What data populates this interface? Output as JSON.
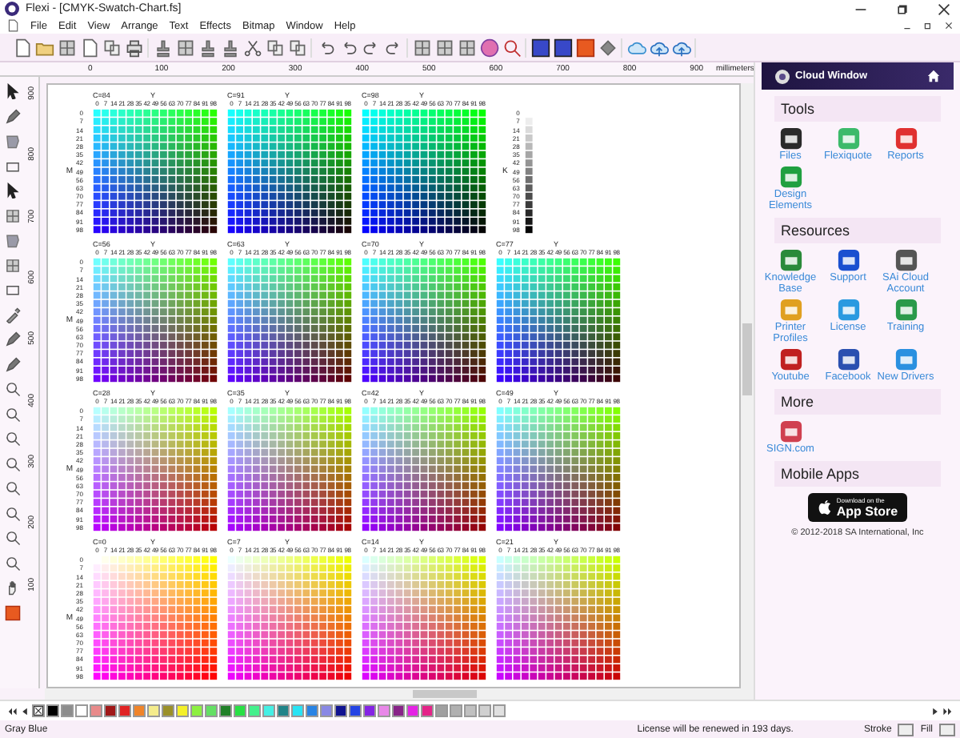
{
  "window": {
    "title": "Flexi - [CMYK-Swatch-Chart.fs]"
  },
  "menu": [
    "File",
    "Edit",
    "View",
    "Arrange",
    "Text",
    "Effects",
    "Bitmap",
    "Window",
    "Help"
  ],
  "ruler": {
    "ticks": [
      "0",
      "100",
      "200",
      "300",
      "400",
      "500",
      "600",
      "700",
      "800",
      "900"
    ],
    "unit": "millimeters",
    "vertical_ticks": [
      "900",
      "800",
      "700",
      "600",
      "500",
      "400",
      "300",
      "200",
      "100"
    ]
  },
  "swatch_chart": {
    "rows": [
      {
        "m_label": "M",
        "m_ticks": [
          "0",
          "7",
          "14",
          "21",
          "28",
          "35",
          "42",
          "49",
          "56",
          "63",
          "70",
          "77",
          "84",
          "91",
          "98"
        ],
        "grids": [
          {
            "label": "C=84",
            "y_label": "Y",
            "y_ticks": [
              "0",
              "7",
              "14",
              "21",
              "28",
              "35",
              "42",
              "49",
              "56",
              "63",
              "70",
              "77",
              "84",
              "91",
              "98"
            ]
          },
          {
            "label": "C=91",
            "y_label": "Y",
            "y_ticks": [
              "0",
              "7",
              "14",
              "21",
              "28",
              "35",
              "42",
              "49",
              "56",
              "63",
              "70",
              "77",
              "84",
              "91",
              "98"
            ]
          },
          {
            "label": "C=98",
            "y_label": "Y",
            "y_ticks": [
              "0",
              "7",
              "14",
              "21",
              "28",
              "35",
              "42",
              "49",
              "56",
              "63",
              "70",
              "77",
              "84",
              "91",
              "98"
            ]
          }
        ]
      },
      {
        "m_label": "M",
        "m_ticks": [
          "0",
          "7",
          "14",
          "21",
          "28",
          "35",
          "42",
          "49",
          "56",
          "63",
          "70",
          "77",
          "84",
          "91",
          "98"
        ],
        "grids": [
          {
            "label": "C=56",
            "y_label": "Y",
            "y_ticks": [
              "0",
              "7",
              "14",
              "21",
              "28",
              "35",
              "42",
              "49",
              "56",
              "63",
              "70",
              "77",
              "84",
              "91",
              "98"
            ]
          },
          {
            "label": "C=63",
            "y_label": "Y",
            "y_ticks": [
              "0",
              "7",
              "14",
              "21",
              "28",
              "35",
              "42",
              "49",
              "56",
              "63",
              "70",
              "77",
              "84",
              "91",
              "98"
            ]
          },
          {
            "label": "C=70",
            "y_label": "Y",
            "y_ticks": [
              "0",
              "7",
              "14",
              "21",
              "28",
              "35",
              "42",
              "49",
              "56",
              "63",
              "70",
              "77",
              "84",
              "91",
              "98"
            ]
          },
          {
            "label": "C=77",
            "y_label": "Y",
            "y_ticks": [
              "0",
              "7",
              "14",
              "21",
              "28",
              "35",
              "42",
              "49",
              "56",
              "63",
              "70",
              "77",
              "84",
              "91",
              "98"
            ]
          }
        ]
      },
      {
        "m_label": "M",
        "m_ticks": [
          "0",
          "7",
          "14",
          "21",
          "28",
          "35",
          "42",
          "49",
          "56",
          "63",
          "70",
          "77",
          "84",
          "91",
          "98"
        ],
        "grids": [
          {
            "label": "C=28",
            "y_label": "Y",
            "y_ticks": [
              "0",
              "7",
              "14",
              "21",
              "28",
              "35",
              "42",
              "49",
              "56",
              "63",
              "70",
              "77",
              "84",
              "91",
              "98"
            ]
          },
          {
            "label": "C=35",
            "y_label": "Y",
            "y_ticks": [
              "0",
              "7",
              "14",
              "21",
              "28",
              "35",
              "42",
              "49",
              "56",
              "63",
              "70",
              "77",
              "84",
              "91",
              "98"
            ]
          },
          {
            "label": "C=42",
            "y_label": "Y",
            "y_ticks": [
              "0",
              "7",
              "14",
              "21",
              "28",
              "35",
              "42",
              "49",
              "56",
              "63",
              "70",
              "77",
              "84",
              "91",
              "98"
            ]
          },
          {
            "label": "C=49",
            "y_label": "Y",
            "y_ticks": [
              "0",
              "7",
              "14",
              "21",
              "28",
              "35",
              "42",
              "49",
              "56",
              "63",
              "70",
              "77",
              "84",
              "91",
              "98"
            ]
          }
        ]
      },
      {
        "m_label": "M",
        "m_ticks": [
          "0",
          "7",
          "14",
          "21",
          "28",
          "35",
          "42",
          "49",
          "56",
          "63",
          "70",
          "77",
          "84",
          "91",
          "98"
        ],
        "grids": [
          {
            "label": "C=0",
            "y_label": "Y",
            "y_ticks": [
              "0",
              "7",
              "14",
              "21",
              "28",
              "35",
              "42",
              "49",
              "56",
              "63",
              "70",
              "77",
              "84",
              "91",
              "98"
            ]
          },
          {
            "label": "C=7",
            "y_label": "Y",
            "y_ticks": [
              "0",
              "7",
              "14",
              "21",
              "28",
              "35",
              "42",
              "49",
              "56",
              "63",
              "70",
              "77",
              "84",
              "91",
              "98"
            ]
          },
          {
            "label": "C=14",
            "y_label": "Y",
            "y_ticks": [
              "0",
              "7",
              "14",
              "21",
              "28",
              "35",
              "42",
              "49",
              "56",
              "63",
              "70",
              "77",
              "84",
              "91",
              "98"
            ]
          },
          {
            "label": "C=21",
            "y_label": "Y",
            "y_ticks": [
              "0",
              "7",
              "14",
              "21",
              "28",
              "35",
              "42",
              "49",
              "56",
              "63",
              "70",
              "77",
              "84",
              "91",
              "98"
            ]
          }
        ]
      }
    ],
    "k_legend": {
      "label": "K",
      "ticks": [
        "0",
        "7",
        "14",
        "21",
        "28",
        "35",
        "42",
        "49",
        "56",
        "63",
        "70",
        "77",
        "84",
        "91",
        "98"
      ]
    }
  },
  "cloud_panel": {
    "title": "Cloud Window",
    "sections": [
      {
        "heading": "Tools",
        "items": [
          "Files",
          "Flexiquote",
          "Reports",
          "Design Elements"
        ]
      },
      {
        "heading": "Resources",
        "items": [
          "Knowledge Base",
          "Support",
          "SAi Cloud Account",
          "Printer Profiles",
          "License",
          "Training",
          "Youtube",
          "Facebook",
          "New Drivers"
        ]
      },
      {
        "heading": "More",
        "items": [
          "SIGN.com"
        ]
      },
      {
        "heading": "Mobile Apps",
        "badge": {
          "line1": "Download on the",
          "line2": "App Store"
        }
      }
    ],
    "copyright": "© 2012-2018 SA International, Inc"
  },
  "palette": [
    {
      "color": "#000000"
    },
    {
      "color": "#8c8c8c"
    },
    {
      "color": "#ffffff"
    },
    {
      "color": "#e88a8a"
    },
    {
      "color": "#a01818"
    },
    {
      "color": "#e02424"
    },
    {
      "color": "#f08428"
    },
    {
      "color": "#f4ec8c"
    },
    {
      "color": "#9a9028"
    },
    {
      "color": "#f4f028"
    },
    {
      "color": "#8cf040"
    },
    {
      "color": "#64e064"
    },
    {
      "color": "#208028"
    },
    {
      "color": "#28e044"
    },
    {
      "color": "#44f08c"
    },
    {
      "color": "#44f0e4"
    },
    {
      "color": "#208488"
    },
    {
      "color": "#28e4f4"
    },
    {
      "color": "#2884e4"
    },
    {
      "color": "#8888e4"
    },
    {
      "color": "#101490"
    },
    {
      "color": "#2444e4"
    },
    {
      "color": "#8424e4"
    },
    {
      "color": "#e888e8"
    },
    {
      "color": "#882488"
    },
    {
      "color": "#e424e4"
    },
    {
      "color": "#e42488"
    },
    {
      "color": "#a0a0a0"
    },
    {
      "color": "#b0b0b0"
    },
    {
      "color": "#c0c0c0"
    },
    {
      "color": "#d0d0d0"
    },
    {
      "color": "#e0e0e0"
    }
  ],
  "status_bar": {
    "color_name": "Gray Blue",
    "message": "License will be renewed in 193 days.",
    "stroke_label": "Stroke",
    "fill_label": "Fill"
  }
}
